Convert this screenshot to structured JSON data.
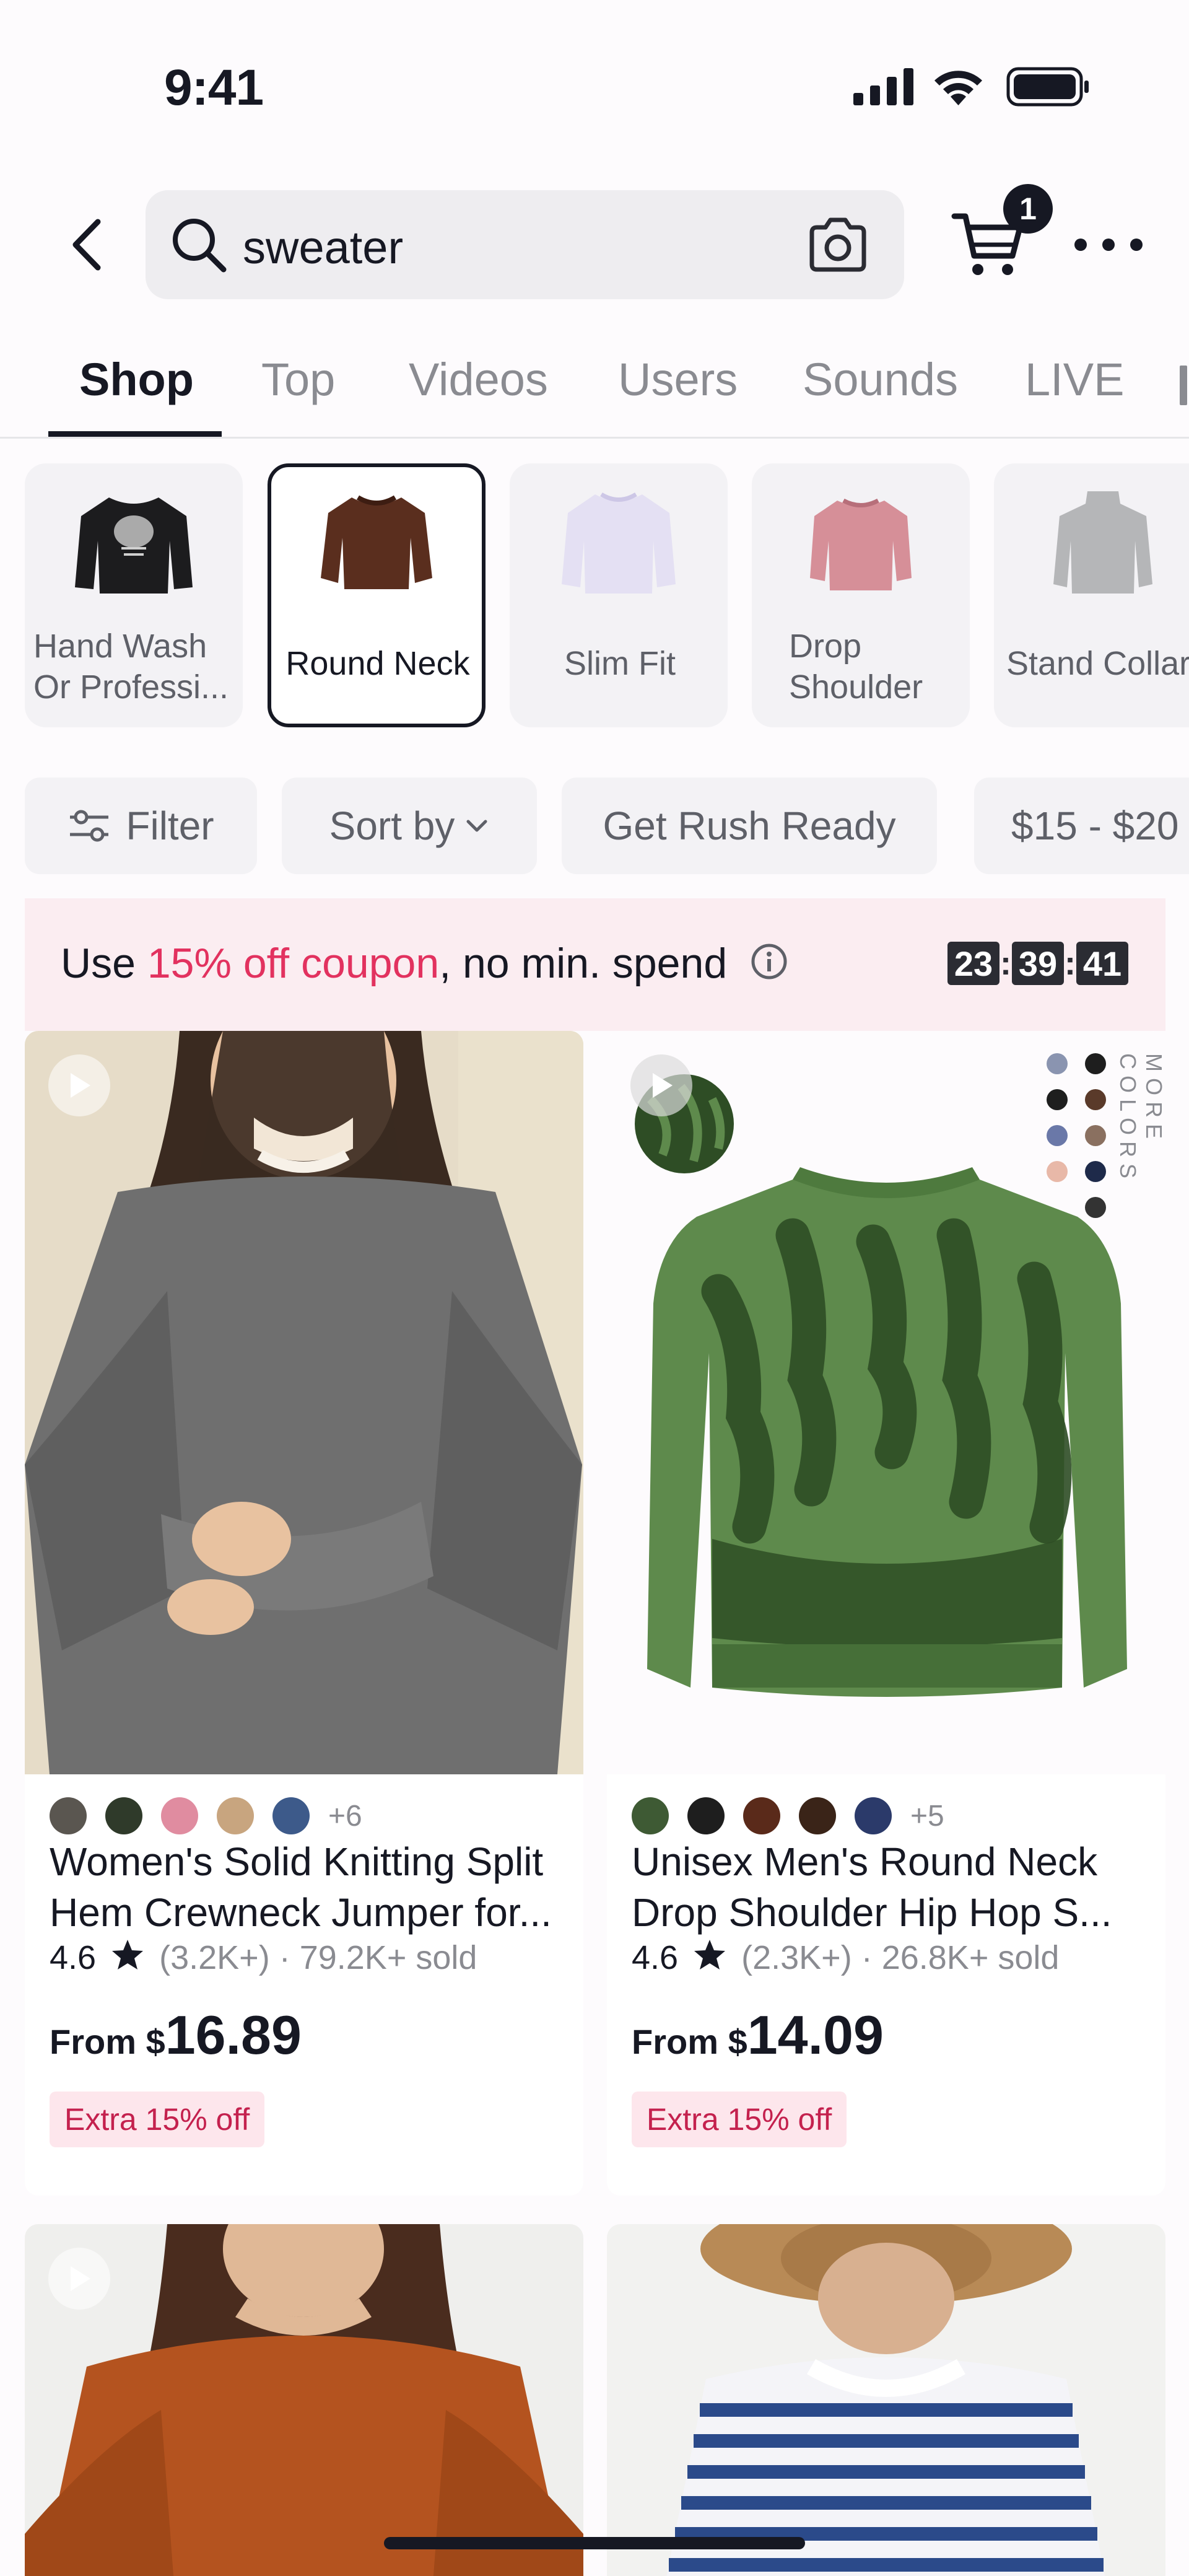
{
  "status_bar": {
    "time": "9:41"
  },
  "header": {
    "search_value": "sweater",
    "cart_count": "1"
  },
  "tabs": [
    {
      "label": "Shop",
      "active": true
    },
    {
      "label": "Top"
    },
    {
      "label": "Videos"
    },
    {
      "label": "Users"
    },
    {
      "label": "Sounds"
    },
    {
      "label": "LIVE"
    }
  ],
  "categories": [
    {
      "label": "Hand Wash Or Professi..."
    },
    {
      "label": "Round Neck",
      "selected": true
    },
    {
      "label": "Slim Fit"
    },
    {
      "label": "Drop Shoulder"
    },
    {
      "label": "Stand Collar"
    }
  ],
  "filters": {
    "filter": "Filter",
    "sort": "Sort by",
    "rush": "Get Rush Ready",
    "price": "$15 - $20"
  },
  "coupon": {
    "prefix": "Use ",
    "highlight": "15% off coupon",
    "suffix": ", no min. spend",
    "timer": [
      "23",
      "39",
      "41"
    ],
    "accent_color": "#e2325f"
  },
  "products": [
    {
      "swatch_colors": [
        "#5a5650",
        "#2f3a2a",
        "#e08ca0",
        "#c8a57f",
        "#3d5a8a"
      ],
      "more_swatches": "+6",
      "title": "Women's Solid Knitting Split Hem Crewneck Jumper for...",
      "rating": "4.6",
      "reviews": "(3.2K+)",
      "sold": "· 79.2K+ sold",
      "price_prefix": "From ",
      "currency": "$",
      "price": "16.89",
      "promo": "Extra 15% off"
    },
    {
      "swatch_colors": [
        "#3e5a34",
        "#1e1e1e",
        "#5a2a1a",
        "#3a2418",
        "#2b3a6a"
      ],
      "more_swatches": "+5",
      "title": "Unisex Men's Round Neck Drop Shoulder Hip Hop S...",
      "rating": "4.6",
      "reviews": "(2.3K+)",
      "sold": "· 26.8K+ sold",
      "price_prefix": "From ",
      "currency": "$",
      "price": "14.09",
      "promo": "Extra 15% off",
      "more_colors_label": "MORE COLORS"
    }
  ]
}
